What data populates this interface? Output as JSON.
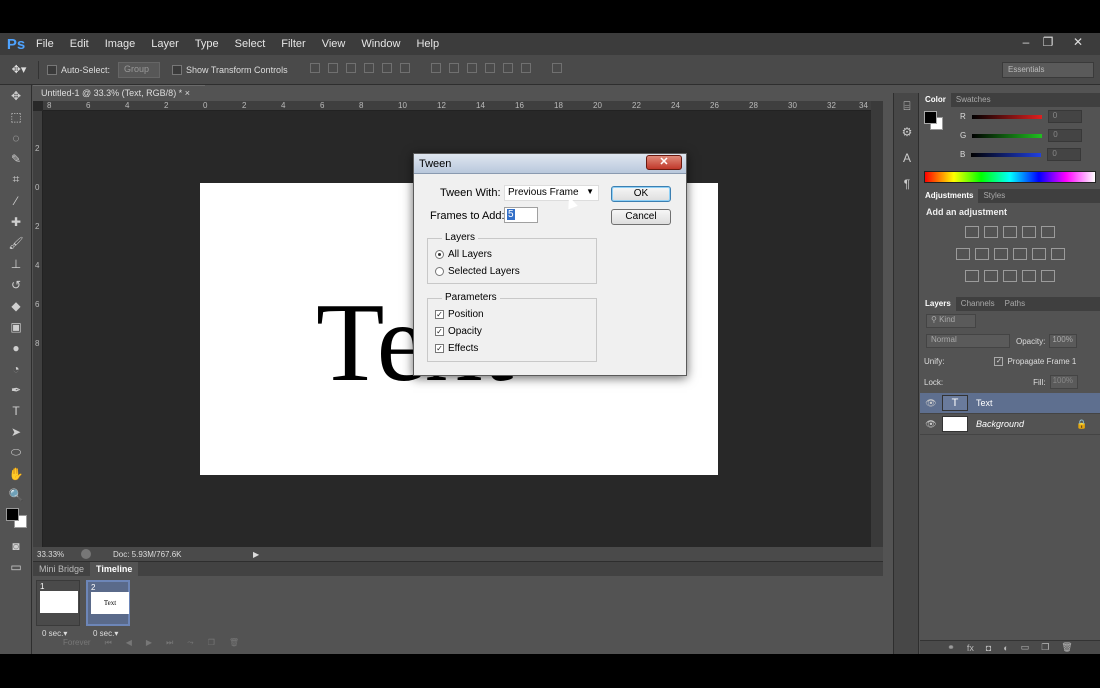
{
  "app": {
    "logo": "Ps"
  },
  "menu": [
    "File",
    "Edit",
    "Image",
    "Layer",
    "Type",
    "Select",
    "Filter",
    "View",
    "Window",
    "Help"
  ],
  "window_controls": {
    "minimize": "–",
    "restore": "❐",
    "close": "✕"
  },
  "options_bar": {
    "auto_select_label": "Auto-Select:",
    "auto_select_value": "Group",
    "transform_label": "Show Transform Controls",
    "workspace": "Essentials"
  },
  "document": {
    "tab_title": "Untitled-1 @ 33.3% (Text, RGB/8) *",
    "canvas_text": "Text",
    "ruler_h": [
      "8",
      "6",
      "4",
      "2",
      "0",
      "2",
      "4",
      "6",
      "8",
      "10",
      "12",
      "14",
      "16",
      "18",
      "20",
      "22",
      "24",
      "26",
      "28",
      "30",
      "32",
      "34"
    ],
    "ruler_v": [
      "2",
      "0",
      "2",
      "4",
      "6",
      "8"
    ]
  },
  "status": {
    "zoom": "33.33%",
    "doc": "Doc: 5.93M/767.6K"
  },
  "timeline": {
    "tabs": [
      "Mini Bridge",
      "Timeline"
    ],
    "frames": [
      {
        "num": "1",
        "delay": "0 sec.▾",
        "thumb": ""
      },
      {
        "num": "2",
        "delay": "0 sec.▾",
        "thumb": "Text"
      }
    ],
    "loop": "Forever"
  },
  "panels": {
    "color_tabs": [
      "Color",
      "Swatches"
    ],
    "channels": [
      {
        "label": "R",
        "value": "0",
        "color": "#e02020"
      },
      {
        "label": "G",
        "value": "0",
        "color": "#20c020"
      },
      {
        "label": "B",
        "value": "0",
        "color": "#2040e0"
      }
    ],
    "adjust_tabs": [
      "Adjustments",
      "Styles"
    ],
    "adjust_title": "Add an adjustment",
    "layer_tabs": [
      "Layers",
      "Channels",
      "Paths"
    ],
    "kind_label": "Kind",
    "blend_mode": "Normal",
    "opacity_label": "Opacity:",
    "opacity_value": "100%",
    "unify_label": "Unify:",
    "propagate_label": "Propagate Frame 1",
    "lock_label": "Lock:",
    "fill_label": "Fill:",
    "fill_value": "100%",
    "layers": [
      {
        "name": "Text",
        "thumb": "T",
        "selected": true
      },
      {
        "name": "Background",
        "thumb": "",
        "selected": false
      }
    ]
  },
  "dialog": {
    "title": "Tween",
    "tween_with_label": "Tween With:",
    "tween_with_value": "Previous Frame",
    "frames_label": "Frames to Add:",
    "frames_value": "5",
    "ok": "OK",
    "cancel": "Cancel",
    "layers_group": "Layers",
    "all_layers": "All Layers",
    "selected_layers": "Selected Layers",
    "params_group": "Parameters",
    "position": "Position",
    "opacity": "Opacity",
    "effects": "Effects"
  }
}
